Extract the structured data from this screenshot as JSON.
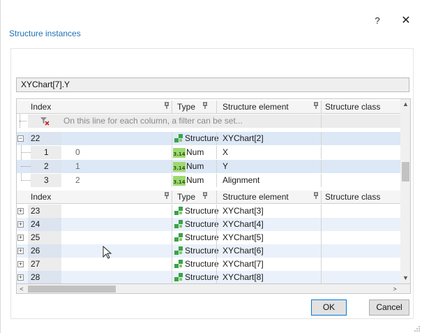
{
  "dialog": {
    "help_label": "?",
    "close_label": "✕",
    "section_title": "Structure instances",
    "path_value": "XYChart[7].Y"
  },
  "columns": {
    "index": "Index",
    "type": "Type",
    "element": "Structure element",
    "class": "Structure class"
  },
  "filter": {
    "hint": "On this line for each column, a filter can be set..."
  },
  "expanded_group": {
    "index": "22",
    "type": "Structure",
    "element": "XYChart[2]",
    "children": [
      {
        "index": "1",
        "value": "0",
        "type_icon": "3.14",
        "type": "Num",
        "element": "X"
      },
      {
        "index": "2",
        "value": "1",
        "type_icon": "3.14",
        "type": "Num",
        "element": "Y"
      },
      {
        "index": "3",
        "value": "2",
        "type_icon": "3.14",
        "type": "Num",
        "element": "Alignment"
      }
    ]
  },
  "rows": [
    {
      "index": "23",
      "type": "Structure",
      "element": "XYChart[3]"
    },
    {
      "index": "24",
      "type": "Structure",
      "element": "XYChart[4]"
    },
    {
      "index": "25",
      "type": "Structure",
      "element": "XYChart[5]"
    },
    {
      "index": "26",
      "type": "Structure",
      "element": "XYChart[6]"
    },
    {
      "index": "27",
      "type": "Structure",
      "element": "XYChart[7]"
    },
    {
      "index": "28",
      "type": "Structure",
      "element": "XYChart[8]"
    }
  ],
  "buttons": {
    "ok": "OK",
    "cancel": "Cancel"
  },
  "scroll": {
    "up": "▲",
    "down": "▼",
    "left": "<",
    "right": ">"
  },
  "icons": {
    "pin": "pin-icon",
    "filter_clear": "filter-clear-icon",
    "structure": "structure-icon",
    "numeric": "numeric-type-icon"
  },
  "colors": {
    "accent": "#1f6fb5",
    "selected_row": "#dde8f6",
    "numeric_icon": "#9ed870",
    "structure_icon": "#3aa24a"
  }
}
